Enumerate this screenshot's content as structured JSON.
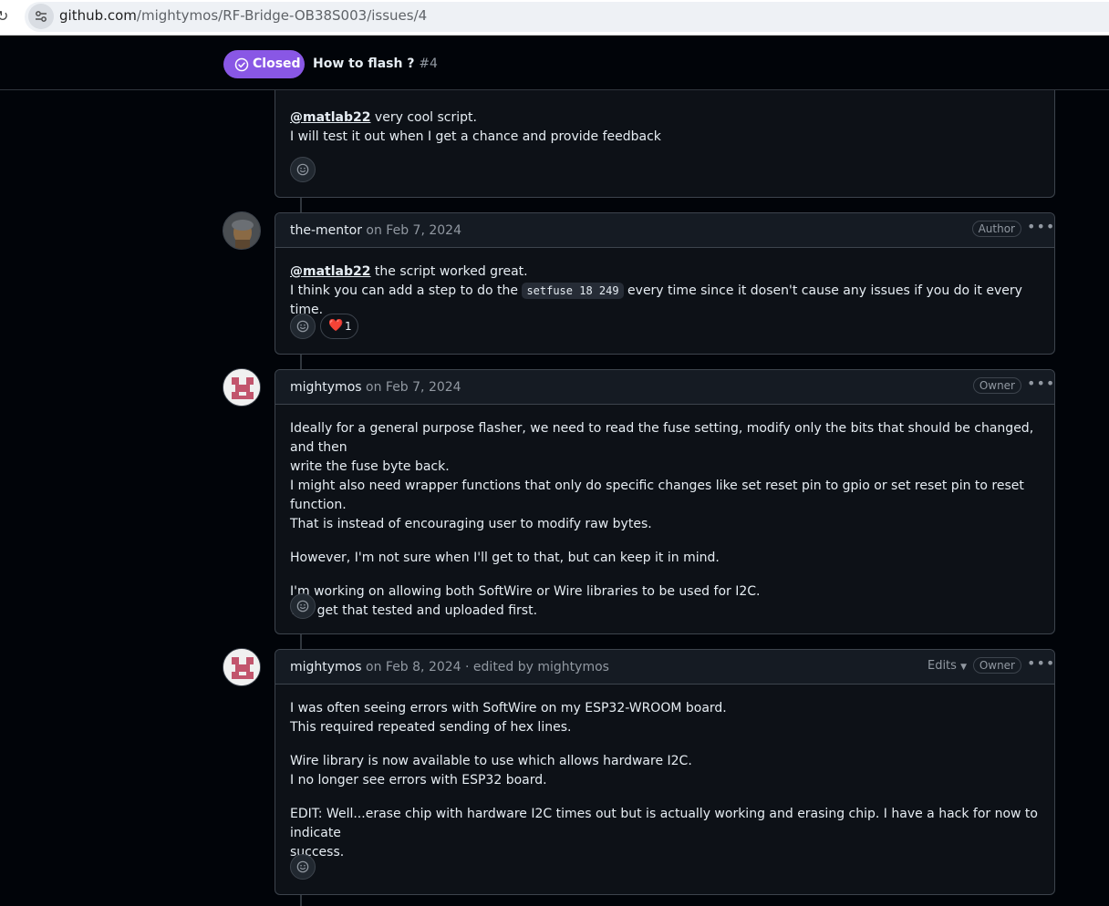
{
  "browser": {
    "url_host": "github.com",
    "url_path": "/mightymos/RF-Bridge-OB38S003/issues/4"
  },
  "issue": {
    "state": "Closed",
    "title": "How to flash ?",
    "number": "#4",
    "state_color": "#8957e5"
  },
  "comments": [
    {
      "lines": [
        {
          "mention": "@matlab22",
          "text": " very cool script."
        },
        {
          "text": "I will test it out when I get a chance and provide feedback"
        }
      ]
    },
    {
      "author": "the-mentor",
      "date": "on Feb 7, 2024",
      "role": "Author",
      "line1_mention": "@matlab22",
      "line1_text": " the script worked great.",
      "line2_before": "I think you can add a step to do the ",
      "line2_code": "setfuse 18 249",
      "line2_after": " every time since it dosen't cause any issues if you do it every time.",
      "reaction": {
        "emoji": "❤️",
        "count": "1"
      }
    },
    {
      "author": "mightymos",
      "date": "on Feb 7, 2024",
      "role": "Owner",
      "paragraphs": [
        [
          "Ideally for a general purpose flasher, we need to read the fuse setting, modify only the bits that should be changed, and then",
          "write the fuse byte back.",
          "I might also need wrapper functions that only do specific changes like set reset pin to gpio or set reset pin to reset function.",
          "That is instead of encouraging user to modify raw bytes."
        ],
        [
          "However, I'm not sure when I'll get to that, but can keep it in mind."
        ],
        [
          "I'm working on allowing both SoftWire or Wire libraries to be used for I2C.",
          "Will get that tested and uploaded first."
        ]
      ]
    },
    {
      "author": "mightymos",
      "date": "on Feb 8, 2024",
      "edited": "· edited by mightymos",
      "edits_label": "Edits",
      "role": "Owner",
      "paragraphs": [
        [
          "I was often seeing errors with SoftWire on my ESP32-WROOM board.",
          "This required repeated sending of hex lines."
        ],
        [
          "Wire library is now available to use which allows hardware I2C.",
          "I no longer see errors with ESP32 board."
        ],
        [
          "EDIT: Well...erase chip with hardware I2C times out but is actually working and erasing chip. I have a hack for now to indicate",
          "success."
        ]
      ]
    }
  ]
}
